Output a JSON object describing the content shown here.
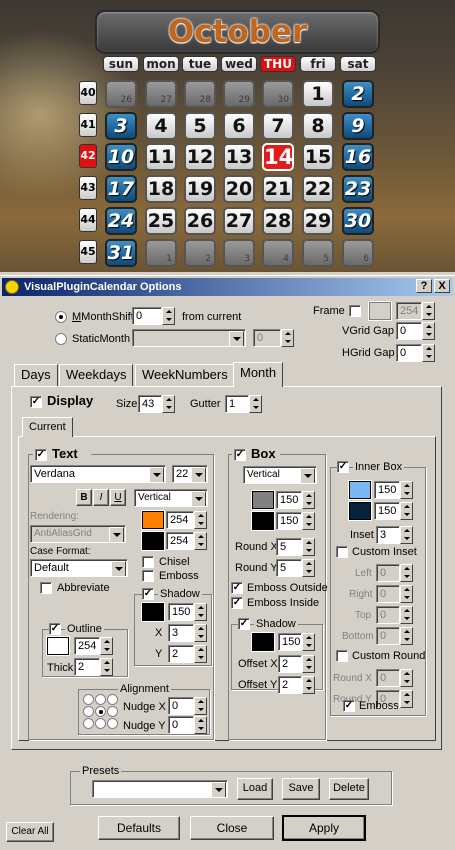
{
  "calendar": {
    "month": "October",
    "day_names": [
      "sun",
      "mon",
      "tue",
      "wed",
      "THU",
      "fri",
      "sat"
    ],
    "today_day_index": 4,
    "week_numbers": [
      "40",
      "41",
      "42",
      "43",
      "44",
      "45"
    ],
    "current_week": "42",
    "rows": [
      [
        {
          "d": "26",
          "t": "g"
        },
        {
          "d": "27",
          "t": "g"
        },
        {
          "d": "28",
          "t": "g"
        },
        {
          "d": "29",
          "t": "g"
        },
        {
          "d": "30",
          "t": "g"
        },
        {
          "d": "1",
          "t": "w"
        },
        {
          "d": "2",
          "t": "b"
        }
      ],
      [
        {
          "d": "3",
          "t": "b"
        },
        {
          "d": "4",
          "t": "w"
        },
        {
          "d": "5",
          "t": "w"
        },
        {
          "d": "6",
          "t": "w"
        },
        {
          "d": "7",
          "t": "w"
        },
        {
          "d": "8",
          "t": "w"
        },
        {
          "d": "9",
          "t": "b"
        }
      ],
      [
        {
          "d": "10",
          "t": "b"
        },
        {
          "d": "11",
          "t": "w"
        },
        {
          "d": "12",
          "t": "w"
        },
        {
          "d": "13",
          "t": "w"
        },
        {
          "d": "14",
          "t": "t"
        },
        {
          "d": "15",
          "t": "w"
        },
        {
          "d": "16",
          "t": "b"
        }
      ],
      [
        {
          "d": "17",
          "t": "b"
        },
        {
          "d": "18",
          "t": "w"
        },
        {
          "d": "19",
          "t": "w"
        },
        {
          "d": "20",
          "t": "w"
        },
        {
          "d": "21",
          "t": "w"
        },
        {
          "d": "22",
          "t": "w"
        },
        {
          "d": "23",
          "t": "b"
        }
      ],
      [
        {
          "d": "24",
          "t": "b"
        },
        {
          "d": "25",
          "t": "w"
        },
        {
          "d": "26",
          "t": "w"
        },
        {
          "d": "27",
          "t": "w"
        },
        {
          "d": "28",
          "t": "w"
        },
        {
          "d": "29",
          "t": "w"
        },
        {
          "d": "30",
          "t": "b"
        }
      ],
      [
        {
          "d": "31",
          "t": "b"
        },
        {
          "d": "1",
          "t": "g"
        },
        {
          "d": "2",
          "t": "g"
        },
        {
          "d": "3",
          "t": "g"
        },
        {
          "d": "4",
          "t": "g"
        },
        {
          "d": "5",
          "t": "g"
        },
        {
          "d": "6",
          "t": "g"
        }
      ]
    ]
  },
  "dialog": {
    "title": "VisualPluginCalendar Options",
    "help_button": "?",
    "close_button": "X",
    "month_shift_label": "MonthShift",
    "month_shift_value": "0",
    "from_current": "from current",
    "static_month_label": "StaticMonth",
    "static_month_value": "0",
    "frame_label": "Frame",
    "frame_value": "254",
    "vgrid_gap_label": "VGrid Gap",
    "vgrid_gap_value": "0",
    "hgrid_gap_label": "HGrid Gap",
    "hgrid_gap_value": "0",
    "tabs": [
      "Days",
      "Weekdays",
      "WeekNumbers",
      "Month"
    ],
    "display_label": "Display",
    "size_label": "Size",
    "size_value": "43",
    "gutter_label": "Gutter",
    "gutter_value": "1",
    "inner_tab": "Current",
    "text": {
      "title": "Text",
      "font": "Verdana",
      "font_size": "22",
      "bold": "B",
      "italic": "I",
      "underline": "U",
      "orientation": "Vertical",
      "rendering_label": "Rendering:",
      "rendering_value": "AntiAliasGrid",
      "color1": "254",
      "color2": "254",
      "case_format_label": "Case Format:",
      "case_format_value": "Default",
      "abbreviate": "Abbreviate",
      "chisel": "Chisel",
      "emboss": "Emboss",
      "shadow": "Shadow",
      "shadow_value": "150",
      "shadow_x_label": "X",
      "shadow_x": "3",
      "shadow_y_label": "Y",
      "shadow_y": "2",
      "outline": "Outline",
      "outline_value": "254",
      "thick_label": "Thick",
      "thick_value": "2",
      "alignment": "Alignment",
      "nudge_x_label": "Nudge X",
      "nudge_x": "0",
      "nudge_y_label": "Nudge Y",
      "nudge_y": "0"
    },
    "box": {
      "title": "Box",
      "orientation": "Vertical",
      "color1": "150",
      "color2": "150",
      "round_x_label": "Round X",
      "round_x": "5",
      "round_y_label": "Round Y",
      "round_y": "5",
      "emboss_outside": "Emboss Outside",
      "emboss_inside": "Emboss Inside",
      "shadow": "Shadow",
      "shadow_value": "150",
      "offset_x_label": "Offset X",
      "offset_x": "2",
      "offset_y_label": "Offset Y",
      "offset_y": "2"
    },
    "inner_box": {
      "title": "Inner Box",
      "color1": "150",
      "color2": "150",
      "inset_label": "Inset",
      "inset": "3",
      "custom_inset": "Custom Inset",
      "left_label": "Left",
      "left": "0",
      "right_label": "Right",
      "right": "0",
      "top_label": "Top",
      "top": "0",
      "bottom_label": "Bottom",
      "bottom": "0",
      "custom_round": "Custom Round",
      "round_x_label": "Round X",
      "round_x": "0",
      "round_y_label": "Round Y",
      "round_y": "0",
      "emboss": "Emboss"
    },
    "presets_label": "Presets",
    "load": "Load",
    "save": "Save",
    "delete": "Delete",
    "clear_all": "Clear All",
    "defaults": "Defaults",
    "close": "Close",
    "apply": "Apply"
  },
  "colors": {
    "text_fg": "#ff7f00",
    "text_bg": "#000000",
    "shadow": "#000000",
    "outline": "#ffffff",
    "box_top": "#808080",
    "box_bottom": "#000000",
    "box_shadow": "#000000",
    "inner_top": "#7ab8f5",
    "inner_bottom": "#06223a"
  }
}
